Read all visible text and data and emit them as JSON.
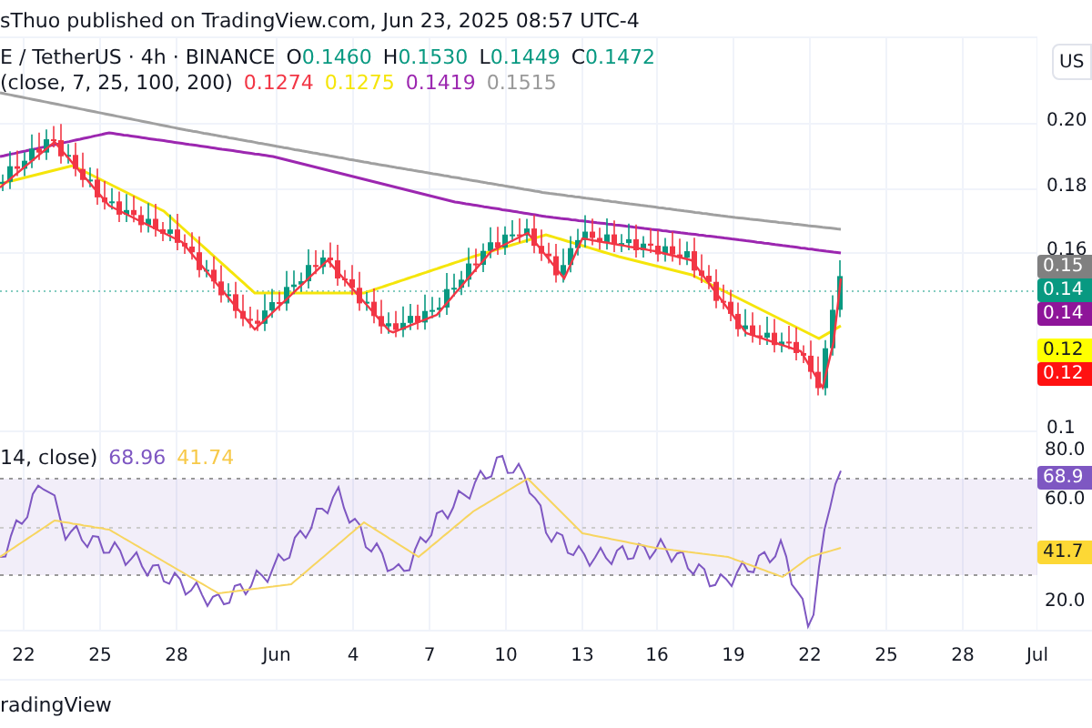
{
  "header": {
    "text": "sThuo published on TradingView.com, Jun 23, 2025 08:57 UTC-4"
  },
  "legend": {
    "symbol": "E / TetherUS · 4h · BINANCE",
    "ohlc": [
      {
        "label": "O",
        "value": "0.1460"
      },
      {
        "label": "H",
        "value": "0.1530"
      },
      {
        "label": "L",
        "value": "0.1449"
      },
      {
        "label": "C",
        "value": "0.1472"
      }
    ]
  },
  "ma_legend": {
    "params": "(close, 7, 25, 100, 200)",
    "values": [
      {
        "text": "0.1274",
        "color": "#f23645"
      },
      {
        "text": "0.1275",
        "color": "#f5e50a"
      },
      {
        "text": "0.1419",
        "color": "#9c27b0"
      },
      {
        "text": "0.1515",
        "color": "#999999"
      }
    ]
  },
  "currency_button": {
    "label": "US"
  },
  "price_axis": {
    "ticks": [
      "0.20",
      "0.18",
      "0.16",
      "0.1"
    ],
    "labels": [
      {
        "text": "0.15",
        "color": "#808080"
      },
      {
        "text": "0.14",
        "color": "#089981"
      },
      {
        "text": "0.14",
        "color": "#8e1599"
      },
      {
        "text": "0.12",
        "color": "#ffff00"
      },
      {
        "text": "0.12",
        "color": "#ff1111"
      }
    ]
  },
  "rsi_legend": {
    "params": "14, close)",
    "values": [
      {
        "text": "68.96",
        "color": "#7e57c2"
      },
      {
        "text": "41.74",
        "color": "#f7c948"
      }
    ]
  },
  "rsi_axis": {
    "ticks": [
      "80.0",
      "60.0",
      "20.0"
    ],
    "labels": [
      {
        "text": "68.9",
        "color": "#7e57c2"
      },
      {
        "text": "41.7",
        "color": "#fdd835"
      }
    ]
  },
  "time_axis": [
    "22",
    "25",
    "28",
    "Jun",
    "4",
    "7",
    "10",
    "13",
    "16",
    "19",
    "22",
    "25",
    "28",
    "Jul"
  ],
  "footer": {
    "text": "radingView"
  }
}
